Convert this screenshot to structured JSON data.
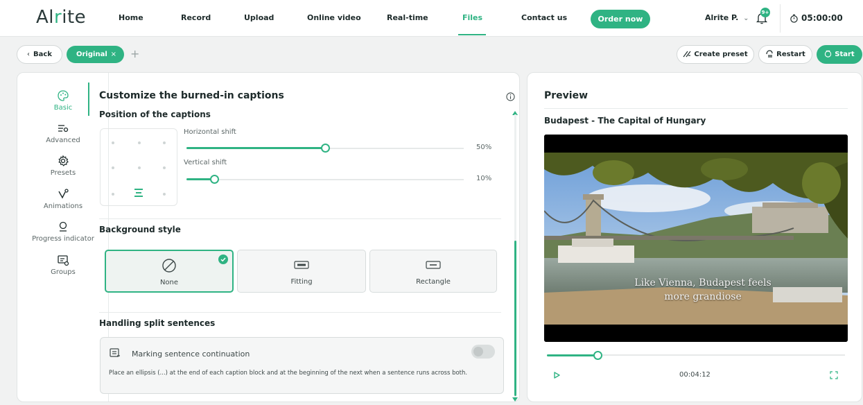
{
  "app": {
    "logo_prefix": "Al",
    "logo_i": "r",
    "logo_suffix": "ite"
  },
  "nav": {
    "items": [
      {
        "label": "Home"
      },
      {
        "label": "Record"
      },
      {
        "label": "Upload"
      },
      {
        "label": "Online video"
      },
      {
        "label": "Real-time"
      },
      {
        "label": "Files"
      },
      {
        "label": "Contact us"
      }
    ],
    "active": "Files",
    "order_label": "Order now",
    "user": "Alrite P.",
    "user_caret": "⌄",
    "notif_badge": "9+",
    "timer": "05:00:00"
  },
  "toolbar": {
    "back_label": "Back",
    "back_icon": "chevron-left-icon",
    "tab_label": "Original",
    "tab_close": "×",
    "add_label": "+",
    "create_preset_label": "Create preset",
    "restart_label": "Restart",
    "start_label": "Start"
  },
  "sidebar": {
    "items": [
      {
        "label": "Basic",
        "icon": "palette-icon",
        "active": true
      },
      {
        "label": "Advanced",
        "icon": "sliders-icon",
        "active": false
      },
      {
        "label": "Presets",
        "icon": "gear-icon",
        "active": false
      },
      {
        "label": "Animations",
        "icon": "animation-icon",
        "active": false
      },
      {
        "label": "Progress indicator",
        "icon": "progress-icon",
        "active": false
      },
      {
        "label": "Groups",
        "icon": "groups-icon",
        "active": false
      }
    ]
  },
  "captions": {
    "title": "Customize the burned-in captions",
    "position_title": "Position of the captions",
    "horizontal_label": "Horizontal shift",
    "horizontal_value": "50%",
    "horizontal_fraction": 0.5,
    "vertical_label": "Vertical shift",
    "vertical_value": "10%",
    "vertical_fraction": 0.1,
    "background_title": "Background style",
    "bg_options": [
      {
        "label": "None",
        "selected": true
      },
      {
        "label": "Fitting",
        "selected": false
      },
      {
        "label": "Rectangle",
        "selected": false
      }
    ],
    "split_title": "Handling split sentences",
    "split_label": "Marking sentence continuation",
    "split_enabled": false,
    "split_desc": "Place an ellipsis (...) at the end of each caption block and at the beginning of the next when a sentence runs across both."
  },
  "preview": {
    "title": "Preview",
    "video_title": "Budapest - The Capital of Hungary",
    "caption_line1": "Like Vienna, Budapest feels",
    "caption_line2": "more grandiose",
    "time": "00:04:12",
    "progress_fraction": 0.17
  },
  "colors": {
    "accent": "#2fb383",
    "text": "#1d2a2a",
    "background": "#f1f2f2"
  }
}
